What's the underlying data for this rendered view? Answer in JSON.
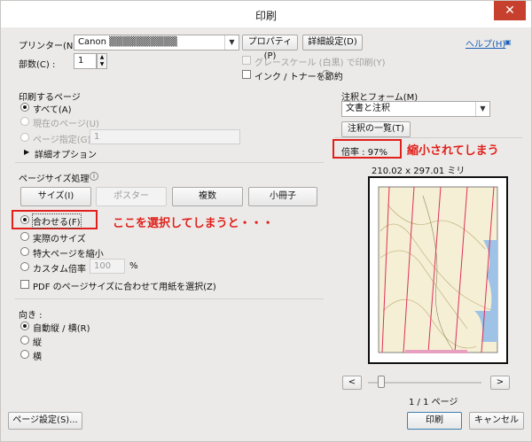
{
  "window": {
    "title": "印刷",
    "close": "✕"
  },
  "printer": {
    "label": "プリンター(N) :",
    "value": "Canon ▒▒▒▒▒▒▒▒▒▒",
    "properties": "プロパティ(P)",
    "advanced": "詳細設定(D)",
    "help": "ヘルプ(H)",
    "grayscale": "グレースケール (白黒) で印刷(Y)",
    "save_ink": "インク / トナーを節約"
  },
  "copies": {
    "label": "部数(C) :",
    "value": "1"
  },
  "pages": {
    "heading": "印刷するページ",
    "all": "すべて(A)",
    "current": "現在のページ(U)",
    "range": "ページ指定(G)",
    "range_value": "1",
    "more": "詳細オプション"
  },
  "sizing": {
    "heading": "ページサイズ処理",
    "size_btn": "サイズ(I)",
    "poster_btn": "ポスター",
    "multiple_btn": "複数",
    "booklet_btn": "小冊子",
    "fit": "合わせる(F)",
    "actual": "実際のサイズ",
    "shrink": "特大ページを縮小",
    "custom": "カスタム倍率 :",
    "custom_value": "100",
    "percent": "%",
    "choose_paper": "PDF のページサイズに合わせて用紙を選択(Z)"
  },
  "orientation": {
    "heading": "向き :",
    "auto": "自動縦 / 横(R)",
    "portrait": "縦",
    "landscape": "横"
  },
  "comments": {
    "heading": "注釈とフォーム(M)",
    "value": "文書と注釈",
    "summary_btn": "注釈の一覧(T)"
  },
  "preview": {
    "scale": "倍率 : 97%",
    "dims": "210.02 x 297.01 ミリ",
    "prev": "<",
    "next": ">",
    "page_count": "1 / 1 ページ"
  },
  "annotations": {
    "fit_note": "ここを選択してしまうと・・・",
    "scale_note": "縮小されてしまう"
  },
  "footer": {
    "page_setup": "ページ設定(S)...",
    "print": "印刷",
    "cancel": "キャンセル"
  },
  "colors": {
    "accent_red": "#e0201b",
    "link": "#1a5fb4"
  }
}
